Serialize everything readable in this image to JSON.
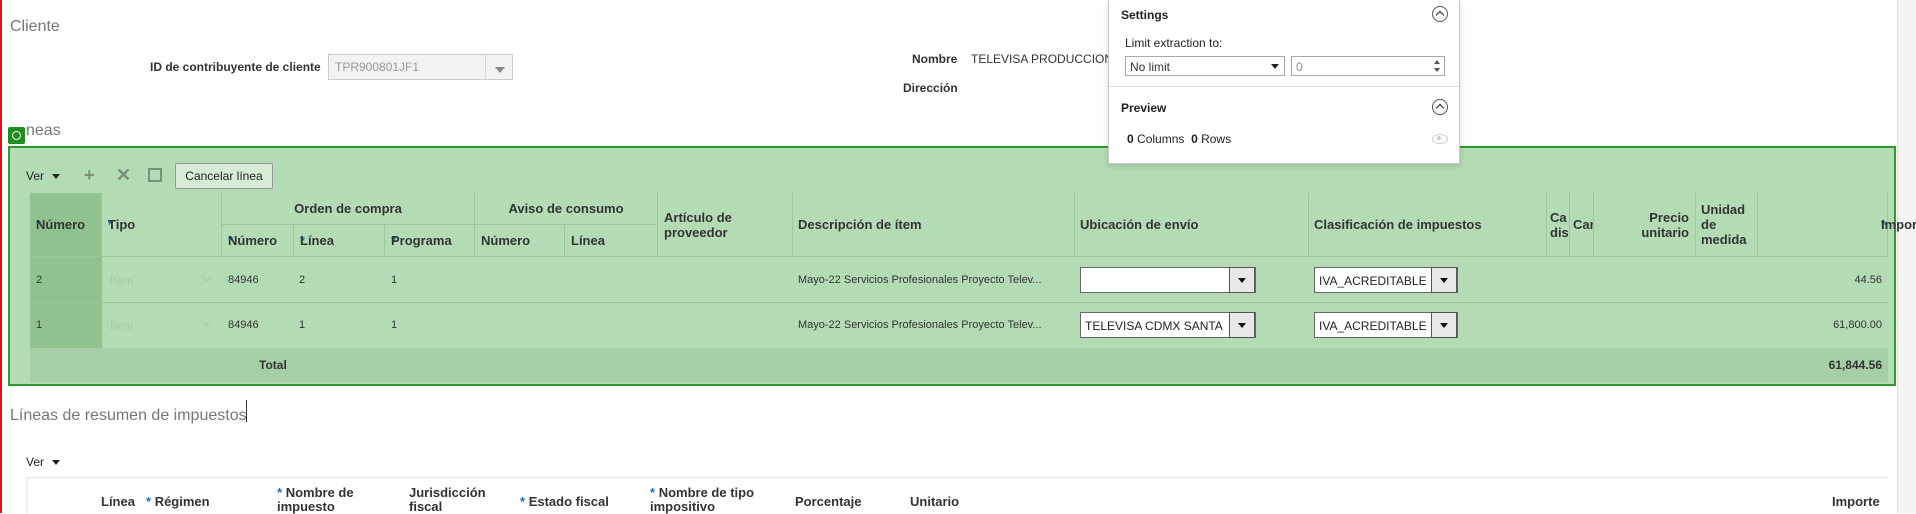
{
  "cliente": {
    "section_title": "Cliente",
    "taxpayer_label": "ID de contribuyente de cliente",
    "taxpayer_value": "TPR900801JF1",
    "nombre_label": "Nombre",
    "nombre_value": "TELEVISA PRODUCCION",
    "direccion_label": "Dirección"
  },
  "lineas": {
    "section_title": "neas",
    "ver_label": "Ver",
    "cancel_button": "Cancelar línea",
    "headers": {
      "numero": "Número",
      "tipo": "Tipo",
      "orden_compra": "Orden de compra",
      "oc_numero": "Número",
      "oc_linea": "Línea",
      "oc_programa": "Programa",
      "aviso_consumo": "Aviso de consumo",
      "ac_numero": "Número",
      "ac_linea": "Línea",
      "articulo_proveedor": "Artículo de proveedor",
      "descripcion": "Descripción de ítem",
      "ubicacion": "Ubicación de envío",
      "clasificacion": "Clasificación de impuestos",
      "ca_dis": "Ca dis",
      "can": "Can",
      "precio_unitario": "Precio unitario",
      "unidad_medida": "Unidad de medida",
      "importe": "Importe",
      "required_mark": "*"
    },
    "rows": [
      {
        "numero": "2",
        "tipo": "Ítem",
        "oc_numero": "84946",
        "oc_linea": "2",
        "oc_programa": "1",
        "descripcion": "Mayo-22 Servicios Profesionales Proyecto Telev...",
        "ubicacion": "",
        "clasificacion": "IVA_ACREDITABLE",
        "importe": "44.56"
      },
      {
        "numero": "1",
        "tipo": "Ítem",
        "oc_numero": "84946",
        "oc_linea": "1",
        "oc_programa": "1",
        "descripcion": "Mayo-22 Servicios Profesionales Proyecto Telev...",
        "ubicacion": "TELEVISA CDMX SANTA",
        "clasificacion": "IVA_ACREDITABLE",
        "importe": "61,800.00"
      }
    ],
    "total_label": "Total",
    "total_value": "61,844.56"
  },
  "settings": {
    "title": "Settings",
    "limit_label": "Limit extraction to:",
    "limit_value": "No limit",
    "limit_number": "0",
    "preview_title": "Preview",
    "columns_count": "0",
    "columns_label": "Columns",
    "rows_count": "0",
    "rows_label": "Rows"
  },
  "resumen": {
    "section_title": "Líneas de resumen de impuestos",
    "ver_label": "Ver",
    "headers": {
      "linea": "Línea",
      "regimen": "Régimen",
      "nombre_impuesto": "Nombre de impuesto",
      "jurisdiccion": "Jurisdicción fiscal",
      "estado_fiscal": "Estado fiscal",
      "tipo_impositivo": "Nombre de tipo impositivo",
      "porcentaje": "Porcentaje",
      "unitario": "Unitario",
      "importe": "Importe"
    }
  },
  "colors": {
    "region_bg": "#b4dcb4",
    "region_border": "#2e9b2e",
    "required": "#1a73b8"
  }
}
